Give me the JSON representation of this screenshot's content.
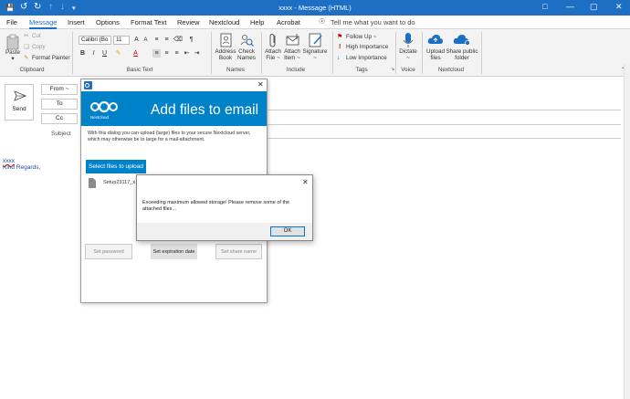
{
  "window": {
    "title": "xxxx  -  Message (HTML)"
  },
  "menu": {
    "tabs": [
      "File",
      "Message",
      "Insert",
      "Options",
      "Format Text",
      "Review",
      "Nextcloud",
      "Help",
      "Acrobat"
    ],
    "active": "Message",
    "tell_me": "Tell me what you want to do"
  },
  "ribbon": {
    "clipboard": {
      "label": "Clipboard",
      "paste": "Paste",
      "cut": "Cut",
      "copy": "Copy",
      "format_painter": "Format Painter"
    },
    "basic_text": {
      "label": "Basic Text",
      "font": "Calibri (Bo",
      "size": "11",
      "bold": "B",
      "italic": "I",
      "underline": "U"
    },
    "names": {
      "label": "Names",
      "address_book": [
        "Address",
        "Book"
      ],
      "check_names": [
        "Check",
        "Names"
      ]
    },
    "include": {
      "label": "Include",
      "attach_file": [
        "Attach",
        "File ~"
      ],
      "attach_item": [
        "Attach",
        "Item ~"
      ],
      "signature": [
        "Signature",
        "~"
      ]
    },
    "tags": {
      "label": "Tags",
      "follow_up": "Follow Up ~",
      "high": "High Importance",
      "low": "Low Importance"
    },
    "voice": {
      "label": "Voice",
      "dictate": [
        "Dictate",
        "~"
      ]
    },
    "nextcloud": {
      "label": "Nextcloud",
      "upload": [
        "Upload",
        "files"
      ],
      "share": [
        "Share public",
        "folder"
      ]
    }
  },
  "compose": {
    "send": "Send",
    "from": "From ~",
    "to": "To",
    "cc": "Cc",
    "subject": "Subject",
    "body_line1": "xxxx",
    "body_line2": "Kind Regards,"
  },
  "nc_dialog": {
    "title": "Add files to email",
    "brand": "Nextcloud",
    "description": "With this dialog you can upload (large) files to your secure Nextcloud server, which may otherwise be to large for a mail-attachment.",
    "select_button": "Select files to upload",
    "file_name": "Setup23117_x",
    "set_password": "Set password",
    "set_expiration": "Set expiration date",
    "set_share_name": "Set share name"
  },
  "msgbox": {
    "message": "Exceeding maximum allowed storage! Please remove some of the attached files...",
    "ok": "OK"
  },
  "colors": {
    "accent": "#1d6fc4",
    "nextcloud_blue": "#0082c9"
  }
}
